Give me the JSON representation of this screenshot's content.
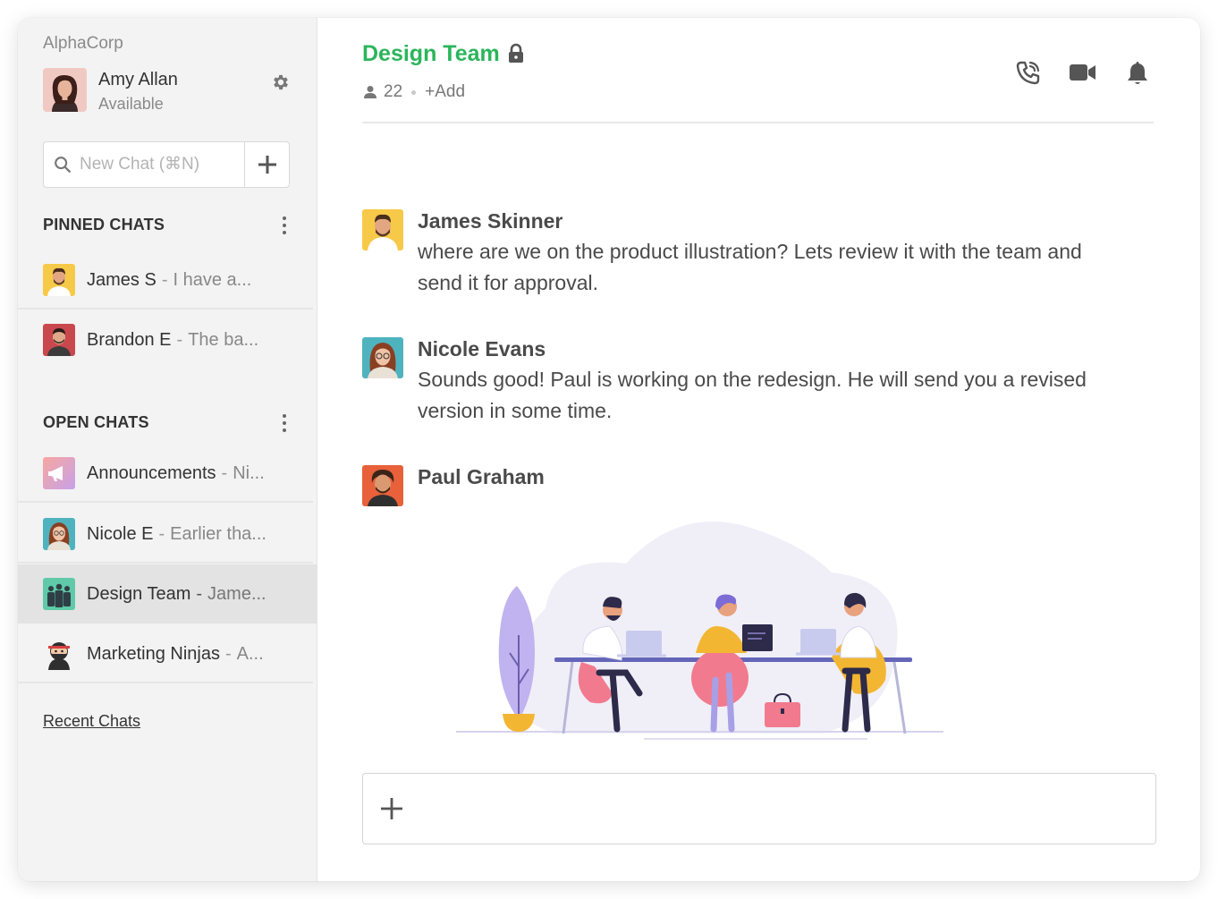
{
  "sidebar": {
    "org_name": "AlphaCorp",
    "user": {
      "name": "Amy Allan",
      "status": "Available"
    },
    "new_chat": {
      "placeholder": "New Chat (⌘N)"
    },
    "pinned": {
      "title": "PINNED CHATS",
      "items": [
        {
          "name": "James S",
          "preview": "I have a..."
        },
        {
          "name": "Brandon E",
          "preview": "The ba..."
        }
      ]
    },
    "open": {
      "title": "OPEN CHATS",
      "items": [
        {
          "name": "Announcements",
          "preview": "Ni..."
        },
        {
          "name": "Nicole E",
          "preview": "Earlier tha..."
        },
        {
          "name": "Design Team",
          "preview": "Jame...",
          "active": true
        },
        {
          "name": "Marketing Ninjas",
          "preview": "A..."
        }
      ]
    },
    "recent_link": "Recent Chats"
  },
  "header": {
    "title": "Design Team",
    "member_count": "22",
    "add_label": "+Add",
    "title_color": "#2bb55b"
  },
  "messages": [
    {
      "author": "James Skinner",
      "text": "where are we on the product illustration? Lets review it with the team and send it for approval."
    },
    {
      "author": "Nicole Evans",
      "text": "Sounds good! Paul is working on the redesign. He will send you a revised version in some time."
    },
    {
      "author": "Paul Graham",
      "text": ""
    }
  ],
  "composer": {
    "placeholder": ""
  },
  "icons": [
    "gear-icon",
    "search-icon",
    "plus-icon",
    "lock-icon",
    "person-icon",
    "phone-icon",
    "video-icon",
    "bell-icon",
    "more-vertical-icon"
  ]
}
